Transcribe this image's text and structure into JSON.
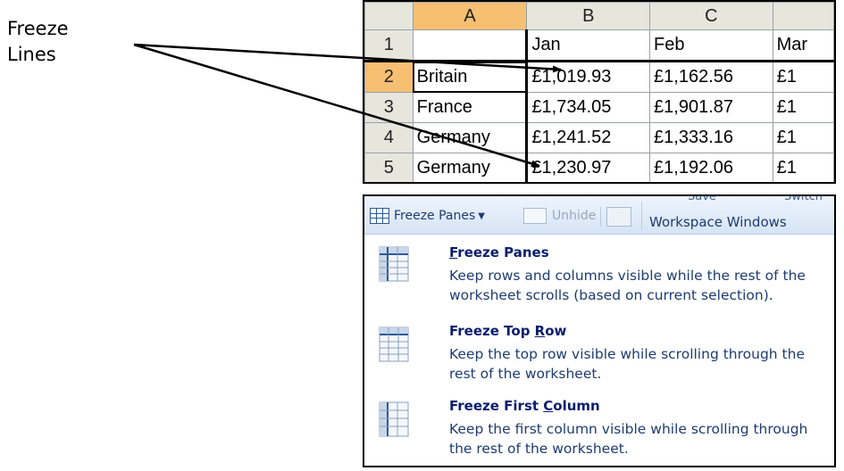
{
  "annotation": {
    "line1": "Freeze",
    "line2": "Lines"
  },
  "sheet": {
    "columns": [
      "A",
      "B",
      "C",
      ""
    ],
    "rows": [
      {
        "num": "1",
        "cells": [
          "",
          "Jan",
          "Feb",
          "Mar"
        ]
      },
      {
        "num": "2",
        "cells": [
          "Britain",
          "£1,019.93",
          "£1,162.56",
          "£1"
        ]
      },
      {
        "num": "3",
        "cells": [
          "France",
          "£1,734.05",
          "£1,901.87",
          "£1"
        ]
      },
      {
        "num": "4",
        "cells": [
          "Germany",
          "£1,241.52",
          "£1,333.16",
          "£1"
        ]
      },
      {
        "num": "5",
        "cells": [
          "Germany",
          "£1,230.97",
          "£1,192.06",
          "£1"
        ]
      }
    ],
    "active_column": "A",
    "active_row": "2"
  },
  "ribbon": {
    "freeze_label": "Freeze Panes",
    "unhide_label": "Unhide",
    "save_top": "Save",
    "switch_top": "Switch",
    "workspace_label": "Workspace Windows"
  },
  "menu": {
    "items": [
      {
        "title_pre": "",
        "title_ul": "F",
        "title_post": "reeze Panes",
        "desc": "Keep rows and columns visible while the rest of the worksheet scrolls (based on current selection)."
      },
      {
        "title_pre": "Freeze Top ",
        "title_ul": "R",
        "title_post": "ow",
        "desc": "Keep the top row visible while scrolling through the rest of the worksheet."
      },
      {
        "title_pre": "Freeze First ",
        "title_ul": "C",
        "title_post": "olumn",
        "desc": "Keep the first column visible while scrolling through the rest of the worksheet."
      }
    ]
  },
  "colors": {
    "header_bg": "#e6e6dc",
    "active_header": "#f6bf72",
    "menu_title": "#0a1d6e",
    "menu_text": "#1e3c72"
  },
  "icons": [
    "arrow-icon",
    "freeze-panes-icon",
    "unhide-icon",
    "side-by-side-icon",
    "freeze-top-row-icon",
    "freeze-first-column-icon"
  ]
}
